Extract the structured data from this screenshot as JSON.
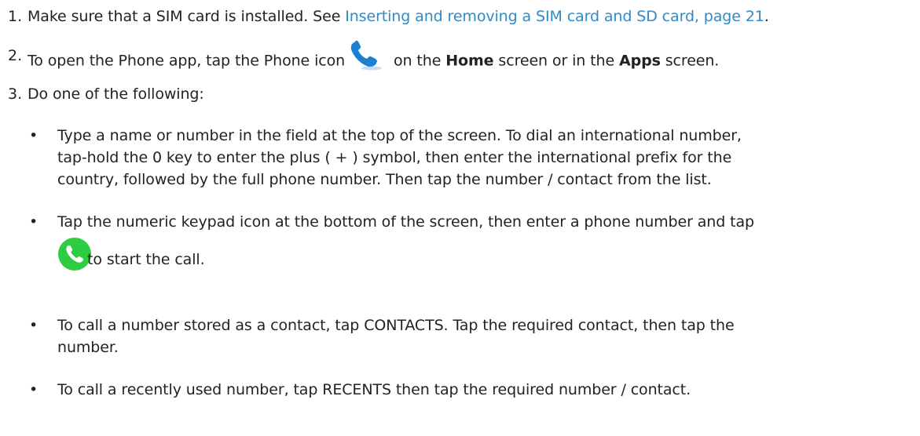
{
  "steps": [
    {
      "number": "1.",
      "text_before": "Make sure that a SIM card is installed. See ",
      "link": "Inserting and removing a SIM card and SD card, page 21",
      "text_after": "."
    },
    {
      "number": "2.",
      "text_a": "To open the Phone app, tap the Phone icon",
      "text_b": " on the ",
      "bold_home": "Home",
      "text_c": " screen or in the ",
      "bold_apps": "Apps",
      "text_d": " screen.",
      "icon": "phone-handset-blue-icon"
    },
    {
      "number": "3.",
      "text": "Do one of the following:"
    }
  ],
  "bullets": [
    {
      "lines": [
        "Type a name or number in the field at the top of the screen. To dial an international number,",
        "tap-hold the 0 key to enter the plus ( + ) symbol, then enter the international prefix for the",
        "country, followed by the full phone number. Then tap the number / contact from the list."
      ]
    },
    {
      "lines": [
        "Tap the numeric keypad icon at the bottom of the screen, then enter a phone number and tap",
        "to start the call."
      ],
      "icon": "green-call-icon"
    },
    {
      "lines": [
        "To call a number stored as a contact, tap CONTACTS. Tap the required contact, then tap the",
        "number."
      ]
    },
    {
      "lines": [
        "To call a recently used number, tap RECENTS then tap the required number / contact."
      ]
    }
  ],
  "bullet_char": "•",
  "colors": {
    "text": "#222222",
    "link": "#2f8ac7",
    "call_green": "#2ecc40",
    "phone_blue": "#1e7fd0"
  }
}
